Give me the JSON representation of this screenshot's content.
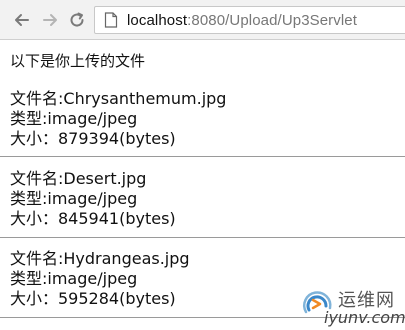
{
  "browser": {
    "url_host": "localhost",
    "url_rest": ":8080/Upload/Up3Servlet",
    "back_icon": "arrow-left-icon",
    "forward_icon": "arrow-right-icon",
    "reload_icon": "reload-icon",
    "page_icon": "info-page-icon"
  },
  "page": {
    "intro": "以下是你上传的文件",
    "files": [
      {
        "name": "文件名:Chrysanthemum.jpg",
        "type": "类型:image/jpeg",
        "size": "大小：879394(bytes)"
      },
      {
        "name": "文件名:Desert.jpg",
        "type": "类型:image/jpeg",
        "size": "大小：845941(bytes)"
      },
      {
        "name": "文件名:Hydrangeas.jpg",
        "type": "类型:image/jpeg",
        "size": "大小：595284(bytes)"
      }
    ]
  },
  "watermark": {
    "top": "运维网",
    "bottom": "iyunv.com"
  }
}
